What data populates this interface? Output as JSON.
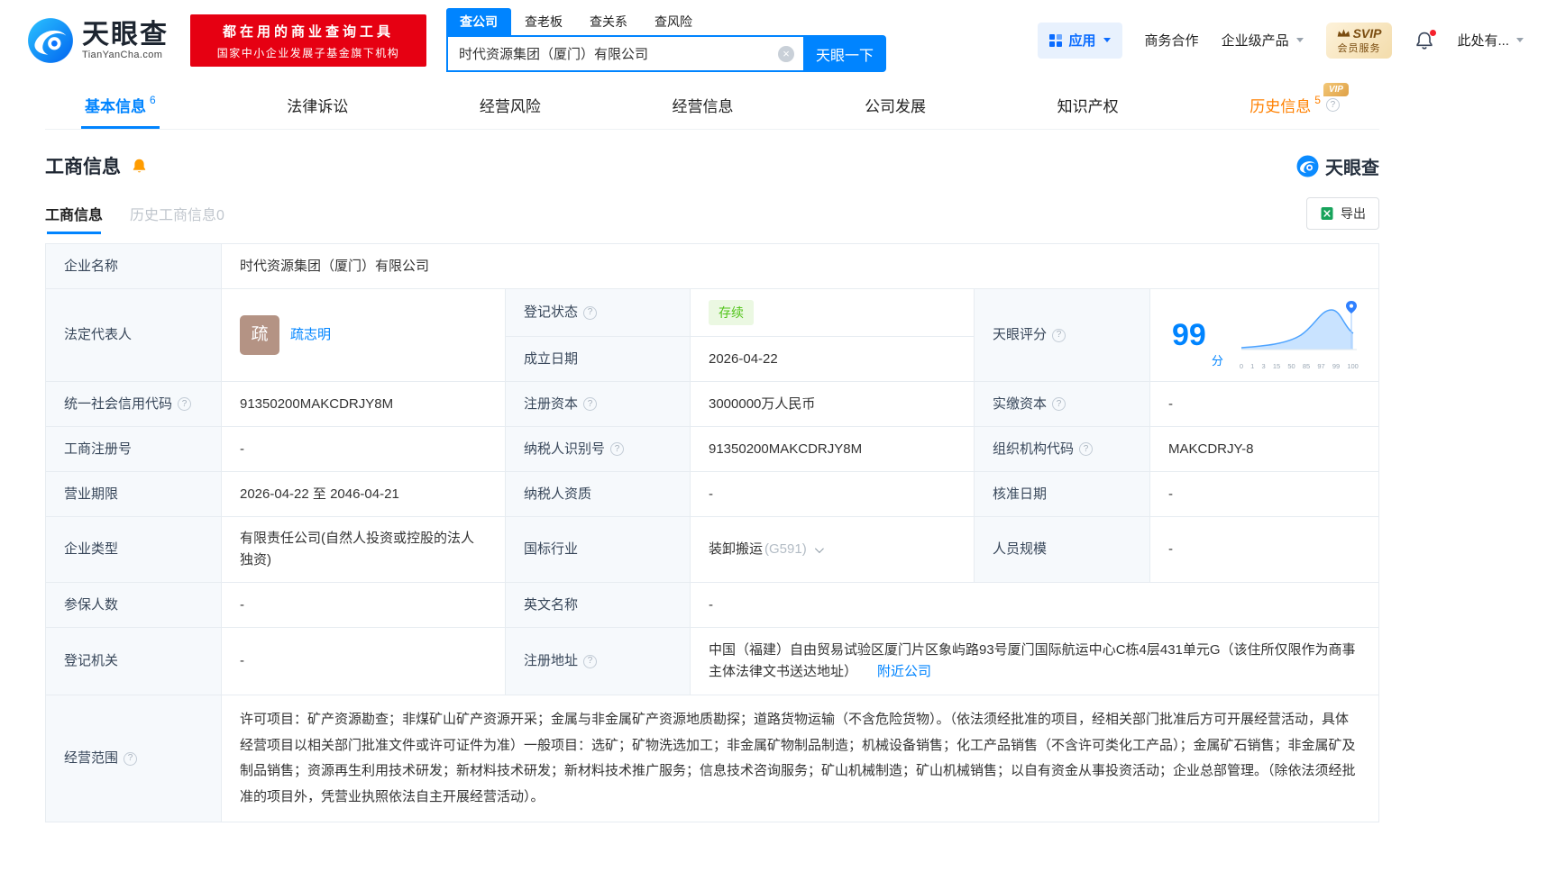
{
  "colors": {
    "brand_blue": "#0084ff",
    "promo_red": "#e60012",
    "status_green": "#52c41a",
    "history_orange": "#ff8000",
    "vip_gold": "#dfa146",
    "label_bg": "#f6f9fc"
  },
  "header": {
    "brand": "天眼查",
    "brand_domain": "TianYanCha.com",
    "promo_line1": "都在用的商业查询工具",
    "promo_line2": "国家中小企业发展子基金旗下机构",
    "search_tabs": [
      {
        "label": "查公司",
        "active": true
      },
      {
        "label": "查老板",
        "active": false
      },
      {
        "label": "查关系",
        "active": false
      },
      {
        "label": "查风险",
        "active": false
      }
    ],
    "search_value": "时代资源集团（厦门）有限公司",
    "search_button": "天眼一下",
    "apps_label": "应用",
    "biz_coop": "商务合作",
    "enterprise_products": "企业级产品",
    "svip_line1": "SVIP",
    "svip_line2": "会员服务",
    "user_label": "此处有..."
  },
  "nav": {
    "vip_tag": "VIP",
    "tabs": [
      {
        "label": "基本信息",
        "count": "6"
      },
      {
        "label": "法律诉讼",
        "count": ""
      },
      {
        "label": "经营风险",
        "count": ""
      },
      {
        "label": "经营信息",
        "count": ""
      },
      {
        "label": "公司发展",
        "count": ""
      },
      {
        "label": "知识产权",
        "count": ""
      },
      {
        "label": "历史信息",
        "count": "5"
      }
    ]
  },
  "section": {
    "title": "工商信息",
    "brand_mark": "天眼查",
    "tab_current": "工商信息",
    "tab_history": "历史工商信息0",
    "export_label": "导出"
  },
  "table": {
    "company_name_label": "企业名称",
    "company_name": "时代资源集团（厦门）有限公司",
    "legal_rep_label": "法定代表人",
    "legal_rep_avatar_char": "疏",
    "legal_rep_name": "疏志明",
    "reg_status_label": "登记状态",
    "reg_status_value": "存续",
    "establish_label": "成立日期",
    "establish_value": "2026-04-22",
    "score_label": "天眼评分",
    "score_value": "99",
    "score_unit": "分",
    "score_axis": [
      "0",
      "1",
      "3",
      "15",
      "50",
      "85",
      "97",
      "99",
      "100"
    ],
    "credit_code_label": "统一社会信用代码",
    "credit_code": "91350200MAKCDRJY8M",
    "reg_capital_label": "注册资本",
    "reg_capital": "3000000万人民币",
    "paid_capital_label": "实缴资本",
    "paid_capital": "-",
    "reg_no_label": "工商注册号",
    "reg_no": "-",
    "taxpayer_id_label": "纳税人识别号",
    "taxpayer_id": "91350200MAKCDRJY8M",
    "org_code_label": "组织机构代码",
    "org_code": "MAKCDRJY-8",
    "biz_term_label": "营业期限",
    "biz_term": "2026-04-22 至 2046-04-21",
    "taxpayer_quality_label": "纳税人资质",
    "taxpayer_quality": "-",
    "approval_date_label": "核准日期",
    "approval_date": "-",
    "company_type_label": "企业类型",
    "company_type": "有限责任公司(自然人投资或控股的法人独资)",
    "industry_label": "国标行业",
    "industry": "装卸搬运",
    "industry_code": "(G591)",
    "staff_size_label": "人员规模",
    "staff_size": "-",
    "insured_label": "参保人数",
    "insured": "-",
    "english_name_label": "英文名称",
    "english_name": "-",
    "reg_authority_label": "登记机关",
    "reg_authority": "-",
    "address_label": "注册地址",
    "address": "中国（福建）自由贸易试验区厦门片区象屿路93号厦门国际航运中心C栋4层431单元G（该住所仅限作为商事主体法律文书送达地址）",
    "nearby_link": "附近公司",
    "scope_label": "经营范围",
    "scope": "许可项目：矿产资源勘查；非煤矿山矿产资源开采；金属与非金属矿产资源地质勘探；道路货物运输（不含危险货物）。（依法须经批准的项目，经相关部门批准后方可开展经营活动，具体经营项目以相关部门批准文件或许可证件为准）一般项目：选矿；矿物洗选加工；非金属矿物制品制造；机械设备销售；化工产品销售（不含许可类化工产品）；金属矿石销售；非金属矿及制品销售；资源再生利用技术研发；新材料技术研发；新材料技术推广服务；信息技术咨询服务；矿山机械制造；矿山机械销售；以自有资金从事投资活动；企业总部管理。（除依法须经批准的项目外，凭营业执照依法自主开展经营活动）。"
  }
}
